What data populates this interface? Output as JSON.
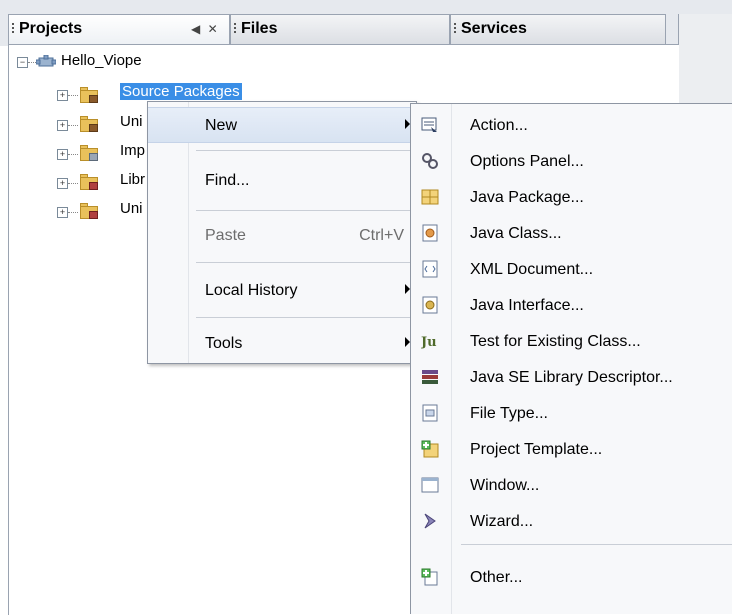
{
  "tabs": {
    "projects": "Projects",
    "files": "Files",
    "services": "Services",
    "minimize_glyph": "◀",
    "close_glyph": "✕"
  },
  "tree": {
    "project_name": "Hello_Viope",
    "selected_node": "Source Packages",
    "nodes_truncated": [
      "Uni",
      "Imp",
      "Libr",
      "Uni"
    ]
  },
  "context_menu": {
    "items": [
      {
        "label": "New",
        "submenu": true
      },
      {
        "label": "Find...",
        "submenu": false
      },
      {
        "label": "Paste",
        "shortcut": "Ctrl+V",
        "disabled": true
      },
      {
        "label": "Local History",
        "submenu": true
      },
      {
        "label": "Tools",
        "submenu": true
      }
    ]
  },
  "new_submenu": {
    "items": [
      {
        "label": "Action...",
        "icon": "action-icon"
      },
      {
        "label": "Options Panel...",
        "icon": "options-panel-icon"
      },
      {
        "label": "Java Package...",
        "icon": "java-package-icon"
      },
      {
        "label": "Java Class...",
        "icon": "java-class-icon"
      },
      {
        "label": "XML Document...",
        "icon": "xml-document-icon"
      },
      {
        "label": "Java Interface...",
        "icon": "java-interface-icon"
      },
      {
        "label": "Test for Existing Class...",
        "icon": "junit-test-icon"
      },
      {
        "label": "Java SE Library Descriptor...",
        "icon": "library-descriptor-icon"
      },
      {
        "label": "File Type...",
        "icon": "file-type-icon"
      },
      {
        "label": "Project Template...",
        "icon": "project-template-icon"
      },
      {
        "label": "Window...",
        "icon": "window-icon"
      },
      {
        "label": "Wizard...",
        "icon": "wizard-icon"
      },
      {
        "label": "Other...",
        "icon": "other-icon"
      }
    ]
  },
  "colors": {
    "selection": "#3a8ee6",
    "folder": "#e9c15b",
    "menu_bg": "#f7f8fa"
  }
}
